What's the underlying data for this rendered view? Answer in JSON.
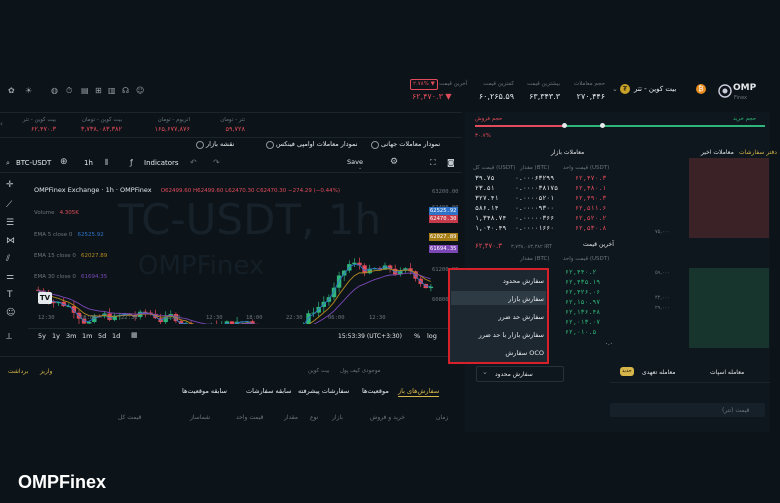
{
  "brand": {
    "name": "OMP",
    "sub": "Finex",
    "watermark": "OMPFinex",
    "chart_watermark_1": "TC-USDT, 1h",
    "chart_watermark_2": "OMPFinex"
  },
  "pair": {
    "name": "بیت کوین - تتر",
    "badge": "₮"
  },
  "stats": [
    {
      "label": "حجم معاملات",
      "value": "۲۷۰,۴۴۶"
    },
    {
      "label": "بیشترین قیمت",
      "value": "۶۳,۳۴۳.۳"
    },
    {
      "label": "کمترین قیمت",
      "value": "۶۰,۲۶۵.۵۹"
    },
    {
      "label": "آخرین قیمت",
      "value": "۶۲,۴۷۰.۳ ▼",
      "badge": "۲.۷۸% ▼"
    }
  ],
  "tickers": [
    {
      "label": "تتر - تومان",
      "value": "۵۹,۷۲۸"
    },
    {
      "label": "اتریوم - تومان",
      "value": "۱۶۵,۶۷۷,۸۷۶"
    },
    {
      "label": "بیت کوین - تومان",
      "value": "۳,۷۳۸,۰۸۳,۳۸۲"
    },
    {
      "label": "بیت کوین - تتر",
      "value": "۶۲,۴۷۰.۳"
    }
  ],
  "chart_tabs": {
    "global": "نمودار معاملات جهانی",
    "omp": "نمودار معاملات اوامپی فینکس",
    "depth": "نقشه بازار"
  },
  "toolbar": {
    "symbol": "BTC-USDT",
    "interval": "1h",
    "indicators": "Indicators",
    "save": "Save"
  },
  "legend": {
    "title": "OMPFinex Exchange · 1h · OMPFinex",
    "ohlc": "O62499.60 H62499.60 L62470.30 C62470.30 −274.29 (−0.44%)",
    "volume": "Volume",
    "volume_value": "4.305K",
    "ema_rows": [
      {
        "label": "EMA 5 close 0",
        "value": "62525.92",
        "color": "#2f73c9"
      },
      {
        "label": "EMA 15 close 0",
        "value": "62027.89",
        "color": "#b38a1f"
      },
      {
        "label": "EMA 30 close 0",
        "value": "61694.35",
        "color": "#7a47b5"
      }
    ]
  },
  "price_axis": {
    "ticks": [
      "63200.00",
      "62400.00",
      "61200.00",
      "60800.00"
    ],
    "marks": [
      "62525.92",
      "62470.30",
      "62027.89",
      "61694.35"
    ]
  },
  "time_axis": {
    "ticks": [
      "12:30",
      "18:00",
      "22:30",
      "06:00",
      "12:30",
      "18:00",
      "22:30",
      "06:00",
      "12:30"
    ]
  },
  "bottom_bar": {
    "ranges": [
      "5y",
      "1y",
      "3m",
      "1m",
      "5d",
      "1d"
    ],
    "time": "15:53:39 (UTC+3:30)",
    "pct": "%",
    "log": "log",
    "auto": "auto"
  },
  "order_tabs": {
    "open": "سفارش‌های باز",
    "positions": "موقعیت‌ها",
    "history": "سفارشات پیشرفته",
    "trades": "سابقه سفارشات",
    "pos_history": "سابقه موقعیت‌ها",
    "filter1": "موجودی کیف پول",
    "filter2": "بیت کوین",
    "action1": "واریز",
    "action2": "برداشت"
  },
  "order_headers": [
    "زمان",
    "خرید و فروش",
    "بازار",
    "نوع",
    "مقدار",
    "قیمت واحد",
    "شماساز",
    "قیمت کل"
  ],
  "order_book": {
    "tab_book": "دفتر سفارشات",
    "tab_trades": "معاملات اخیر",
    "tab_market": "معاملات بازار",
    "sell_label": "حجم فروش",
    "buy_label": "حجم خرید",
    "sell_pct": "۳۰.۷%",
    "buy_pct": "۶۹.۳%",
    "headers": [
      "قیمت واحد (USDT)",
      "مقدار (BTC)",
      "قیمت کل (USDT)"
    ],
    "asks": [
      [
        "۶۲,۴۷۰.۳",
        "۰.۰۰۰۶۳۲۹۹",
        "۳۹.۷۵"
      ],
      [
        "۶۲,۴۸۰.۱",
        "۰.۰۰۰۰۳۸۱۷۵",
        "۲۳.۵۱"
      ],
      [
        "۶۲,۴۹۰.۳",
        "۰.۰۰۰۰۵۲۰۱",
        "۳۲۷.۴۱"
      ],
      [
        "۶۲,۵۱۱.۶",
        "۰.۰۰۰۰۹۳۰۰",
        "۵۸۶.۱۴"
      ],
      [
        "۶۲,۵۲۰.۲",
        "۰.۰۰۰۰۰۳۶۶",
        "۱,۳۴۸.۷۴"
      ],
      [
        "۶۲,۵۳۰.۸",
        "۰.۰۰۰۰۱۶۶۰",
        "۱,۰۴۰.۴۹"
      ]
    ],
    "last_price_label": "آخرین قیمت",
    "last_price": "۶۲,۴۷۰.۳",
    "last_irt": "۳,۷۳۸,۰۸۳,۳۸۲ IRT",
    "bids": [
      [
        "۶۲,۴۴۰.۲",
        "۰.۰۰۰۰",
        "۰۰"
      ],
      [
        "۶۲,۴۳۵.۱۹",
        "۰.۰۰۰۰",
        "۲۹"
      ],
      [
        "۶۲,۴۲۶.۰۶",
        "۰.۰۰۰۰",
        "۰۱"
      ],
      [
        "۶۲,۱۵۰.۹۷",
        "۰.۰۰۰۰",
        "۱۱۰۱"
      ],
      [
        "۶۲,۱۳۶.۴۸",
        "۰.۰۰۰۰",
        "۸۱"
      ],
      [
        "۶۲,۰۱۳.۰۷",
        "۰.۰۰۰۰",
        "۱۹"
      ],
      [
        "۶۲,۰۱۰.۵",
        "۰.۰۰۰۰",
        "۷۲۷"
      ]
    ],
    "decimals": "۰.۰"
  },
  "depth": {
    "y1": "۷۵,۰۰۰",
    "y2": "۵۹,۰۰۰",
    "y3": "۴۴,۰۰۰",
    "y4": "۲۹,۰۰۰"
  },
  "dropdown": {
    "current": "سفارش محدود",
    "items": [
      "سفارش محدود",
      "سفارش بازار",
      "سفارش حد ضرر",
      "سفارش بازار با حد ضرر",
      "سفارش OCO"
    ]
  },
  "trade": {
    "spot": "معامله اسپات",
    "margin": "معامله تعهدی",
    "badge": "جدید",
    "price_placeholder": "قیمت (تتر)"
  }
}
